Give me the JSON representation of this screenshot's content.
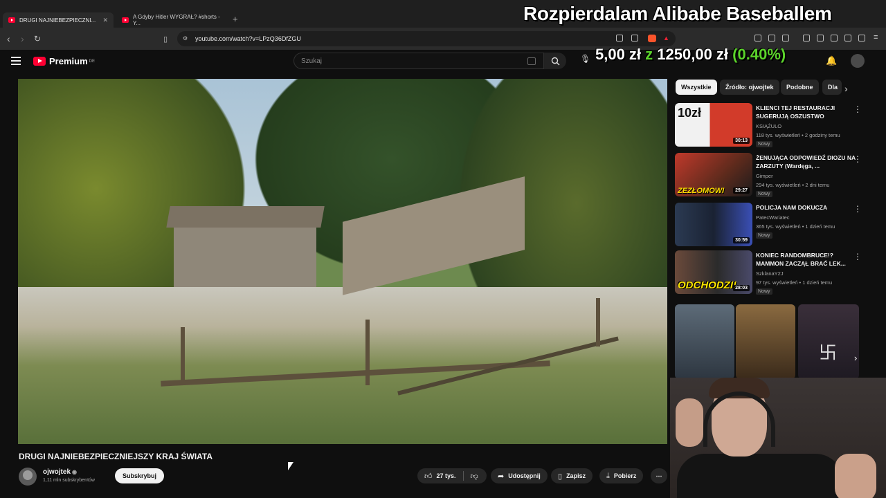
{
  "browser": {
    "tabs": [
      {
        "label": "DRUGI NAJNIEBEZPIECZNIEJSZY KRAJ ŚWIATA - YouTube",
        "short": "DRUGI NAJNIEBEZPIECZNI...",
        "active": true
      },
      {
        "label": "A Gdyby Hitler WYGRAŁ? #shorts - YouTube",
        "short": "A Gdyby Hitler WYGRAŁ? #shorts - Y...",
        "active": false
      }
    ],
    "new_tab": "+",
    "url": "youtube.com/watch?v=LPzQ36DfZGU"
  },
  "overlay": {
    "title": "Rozpierdalam Alibabe Baseballem",
    "money_current": "5,00 zł",
    "money_sep": "z",
    "money_goal": "1250,00 zł",
    "money_pct": "(0.40%)",
    "accent": "#5bd32b"
  },
  "youtube": {
    "logo": "Premium",
    "logo_region": "DE",
    "search_placeholder": "Szukaj",
    "brand_color": "#ff0033"
  },
  "video": {
    "title": "DRUGI NAJNIEBEZPIECZNIEJSZY KRAJ ŚWIATA",
    "channel": "ojwojtek",
    "subscribers": "1,11 mln subskrybentów",
    "subscribe_label": "Subskrybuj",
    "likes": "27 tys.",
    "share_label": "Udostępnij",
    "save_label": "Zapisz",
    "download_label": "Pobierz"
  },
  "chips": [
    "Wszystkie",
    "Źródło: ojwojtek",
    "Podobne",
    "Dla"
  ],
  "recommendations": [
    {
      "title": "KLIENCI TEJ RESTAURACJI SUGERUJĄ OSZUSTWO",
      "channel": "KSIĄŻULO",
      "meta": "118 tys. wyświetleń • 2 godziny temu",
      "badge": "Nowy",
      "duration": "30:13",
      "thumb_text": "10zł"
    },
    {
      "title": "ŻENUJĄCA ODPOWIEDŹ DIOZU NA ZARZUTY (Wardęga, ...",
      "channel": "Gimper",
      "meta": "294 tys. wyświetleń • 2 dni temu",
      "badge": "Nowy",
      "duration": "29:27",
      "thumb_text": "ZEZŁOMOWI"
    },
    {
      "title": "POLICJA NAM DOKUCZA",
      "channel": "PatecWariatec",
      "meta": "365 tys. wyświetleń • 1 dzień temu",
      "badge": "Nowy",
      "duration": "30:59",
      "thumb_text": ""
    },
    {
      "title": "KONIEC RANDOMBRUCE!? MAMMON ZACZĄŁ BRAĆ LEK...",
      "channel": "SzklanaY2J",
      "meta": "97 tys. wyświetleń • 1 dzień temu",
      "badge": "Nowy",
      "duration": "28:03",
      "thumb_text": "ODCHODZI!"
    }
  ]
}
